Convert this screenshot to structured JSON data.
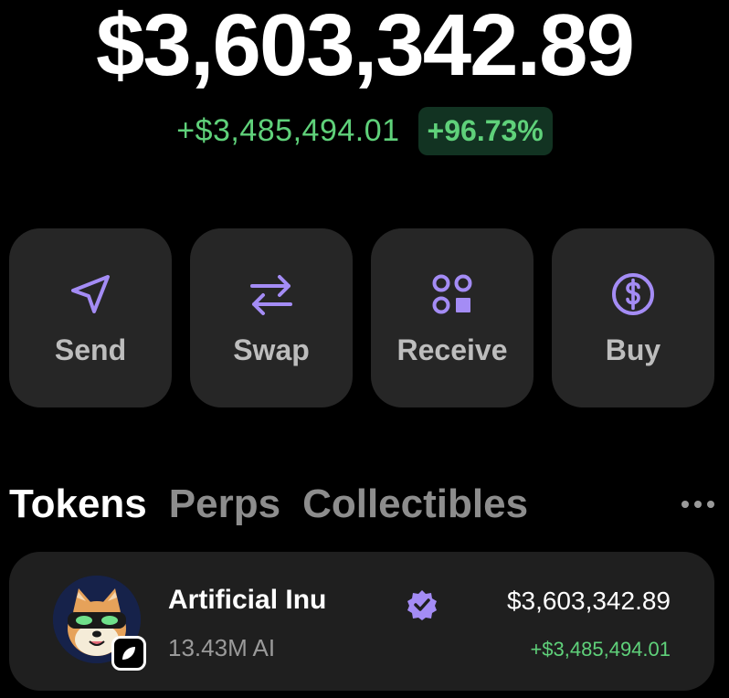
{
  "portfolio": {
    "balance": "$3,603,342.89",
    "change_amount": "+$3,485,494.01",
    "change_percent": "+96.73%"
  },
  "actions": [
    {
      "label": "Send",
      "icon": "send-icon"
    },
    {
      "label": "Swap",
      "icon": "swap-icon"
    },
    {
      "label": "Receive",
      "icon": "receive-icon"
    },
    {
      "label": "Buy",
      "icon": "dollar-icon"
    }
  ],
  "tabs": [
    {
      "label": "Tokens",
      "active": true
    },
    {
      "label": "Perps",
      "active": false
    },
    {
      "label": "Collectibles",
      "active": false
    }
  ],
  "tokens": [
    {
      "name": "Artificial Inu",
      "amount": "13.43M AI",
      "value": "$3,603,342.89",
      "change": "+$3,485,494.01",
      "verified": true
    }
  ],
  "colors": {
    "background": "#000000",
    "card": "#262626",
    "accent_purple": "#a48cf5",
    "positive_green": "#5fd17a",
    "positive_bg": "#123322",
    "muted_text": "#8d8d8d"
  }
}
